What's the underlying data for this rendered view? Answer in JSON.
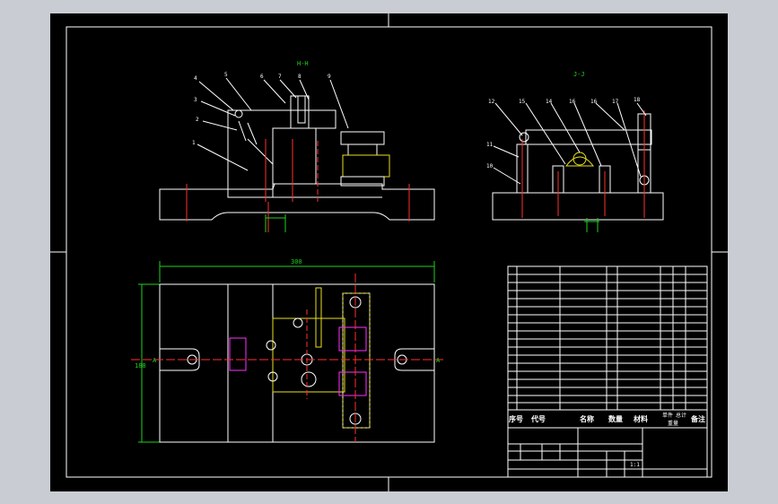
{
  "views": {
    "left_section_label": "H-H",
    "right_section_label": "J-J",
    "overall_dimension": "300",
    "side_dimension": "188",
    "section_marker_a_left": "A",
    "section_marker_a_right": "A"
  },
  "balloons_left": [
    "4",
    "5",
    "6",
    "7",
    "8",
    "9",
    "3",
    "2",
    "1"
  ],
  "balloons_right": [
    "12",
    "15",
    "14",
    "16",
    "16",
    "17",
    "18",
    "11",
    "10"
  ],
  "title_block": {
    "col_seq": "序号",
    "col_code": "代号",
    "col_name": "名称",
    "col_qty": "数量",
    "col_material": "材料",
    "col_weight_single": "单件",
    "col_weight_total": "总计",
    "col_weight": "重量",
    "col_remark": "备注",
    "scale": "1:1"
  },
  "colors": {
    "background": "#000000",
    "outline": "#ffffff",
    "dimension": "#20d020",
    "hatch": "#20e0e0",
    "center": "#ff3030",
    "highlight": "#e8e020",
    "section": "#ff30ff"
  }
}
